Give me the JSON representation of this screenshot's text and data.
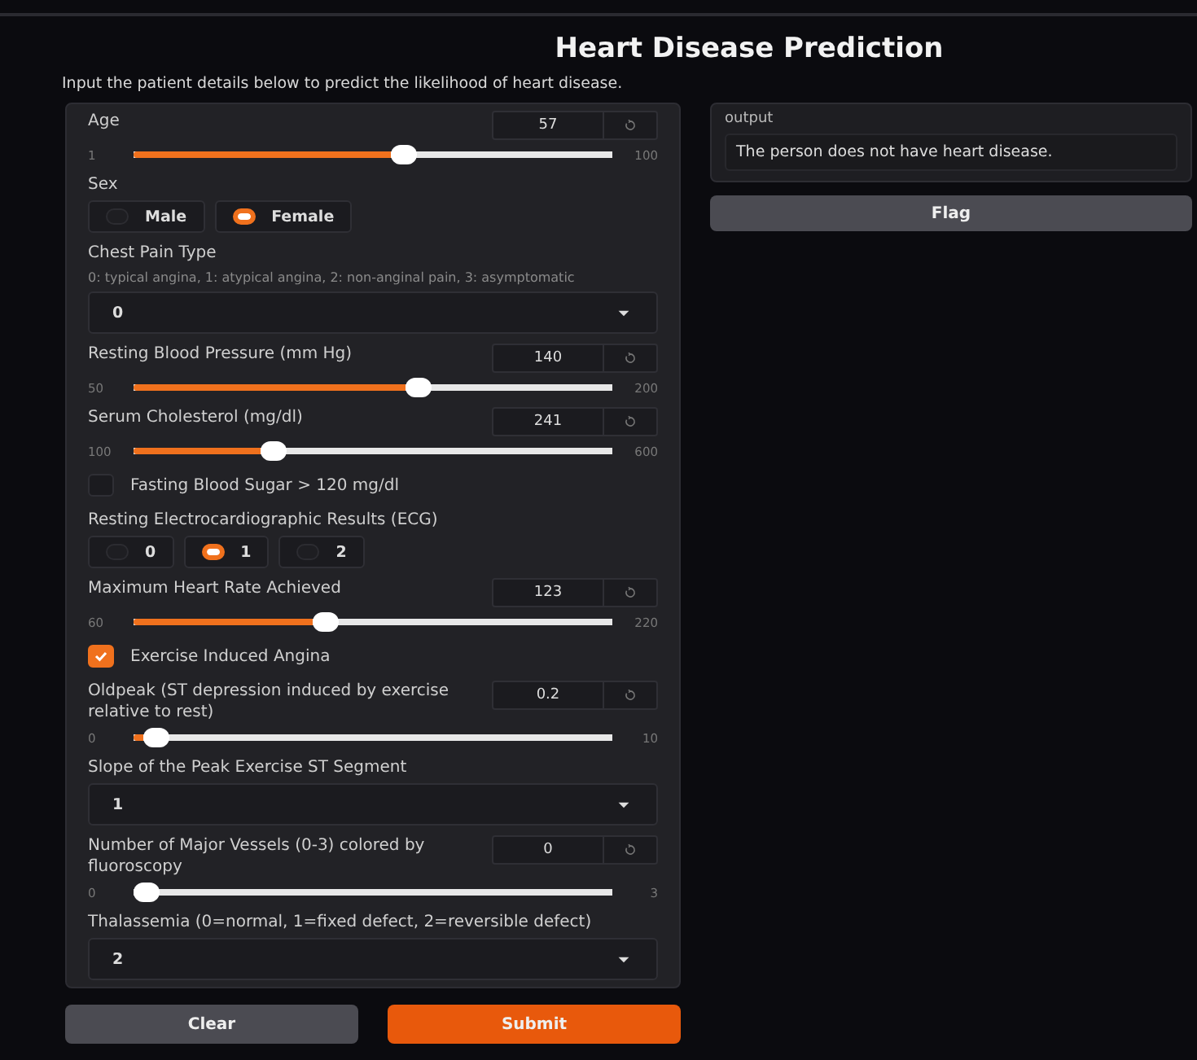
{
  "title": "Heart Disease Prediction",
  "description": "Input the patient details below to predict the likelihood of heart disease.",
  "inputs": [
    {
      "kind": "slider",
      "label": "Age",
      "value": "57",
      "min": "1",
      "max": "100",
      "level": 0.57
    },
    {
      "kind": "radio",
      "label": "Sex",
      "options": [
        {
          "label": "Male",
          "selected": false
        },
        {
          "label": "Female",
          "selected": true
        }
      ]
    },
    {
      "kind": "dropdown",
      "label": "Chest Pain Type",
      "info": "0: typical angina, 1: atypical angina, 2: non-anginal pain, 3: asymptomatic",
      "value": "0"
    },
    {
      "kind": "slider",
      "label": "Resting Blood Pressure (mm Hg)",
      "value": "140",
      "min": "50",
      "max": "200",
      "level": 0.6
    },
    {
      "kind": "slider",
      "label": "Serum Cholesterol (mg/dl)",
      "value": "241",
      "min": "100",
      "max": "600",
      "level": 0.282
    },
    {
      "kind": "checkbox",
      "label": "Fasting Blood Sugar > 120 mg/dl",
      "checked": false
    },
    {
      "kind": "radio",
      "label": "Resting Electrocardiographic Results (ECG)",
      "options": [
        {
          "label": "0",
          "selected": false
        },
        {
          "label": "1",
          "selected": true
        },
        {
          "label": "2",
          "selected": false
        }
      ]
    },
    {
      "kind": "slider",
      "label": "Maximum Heart Rate Achieved",
      "value": "123",
      "min": "60",
      "max": "220",
      "level": 0.394
    },
    {
      "kind": "checkbox",
      "label": "Exercise Induced Angina",
      "checked": true
    },
    {
      "kind": "slider",
      "label": "Oldpeak (ST depression induced by exercise relative to rest)",
      "value": "0.2",
      "min": "0",
      "max": "10",
      "level": 0.02
    },
    {
      "kind": "dropdown",
      "label": "Slope of the Peak Exercise ST Segment",
      "value": "1"
    },
    {
      "kind": "slider",
      "label": "Number of Major Vessels (0-3) colored by fluoroscopy",
      "value": "0",
      "min": "0",
      "max": "3",
      "level": 0
    },
    {
      "kind": "dropdown",
      "label": "Thalassemia (0=normal, 1=fixed defect, 2=reversible defect)",
      "value": "2"
    }
  ],
  "output": {
    "label": "output",
    "value": "The person does not have heart disease."
  },
  "flag_button": "Flag",
  "buttons": [
    {
      "label": "Clear",
      "kind": "secondary"
    },
    {
      "label": "Submit",
      "kind": "primary"
    }
  ]
}
